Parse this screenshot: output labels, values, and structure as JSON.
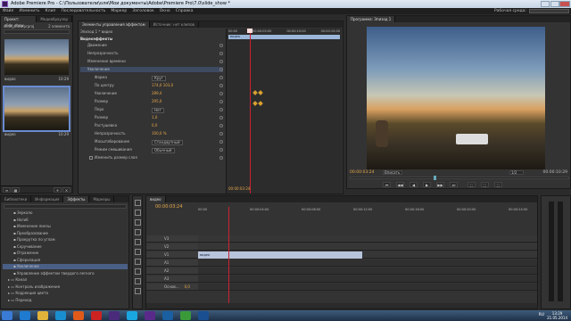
{
  "window": {
    "title": "Adobe Premiere Pro - C:\\Пользователи\\оля\\Мои документы\\Adobe\\Premiere Pro\\7.0\\slide_show *"
  },
  "menu": [
    "Файл",
    "Изменить",
    "Клип",
    "Последовательность",
    "Маркер",
    "Заголовок",
    "Окно",
    "Справка"
  ],
  "workspace_label": "Рабочая среда:",
  "project": {
    "tab": "Проект: slide_show",
    "tab2": "Медиабраузер",
    "file": "slide_show.prproj",
    "count": "2 элемента",
    "items": [
      {
        "name": "видео",
        "dur": "10:29"
      },
      {
        "name": "видео",
        "dur": "10:29"
      }
    ]
  },
  "effect_controls": {
    "tabs": [
      "Элементы управления эффектом",
      "Источник: нет клипов"
    ],
    "clip": "Эпизод 1 * видео",
    "video_effects": "Видеоэффекты",
    "rows": [
      {
        "label": "Движение",
        "indent": 1,
        "fx": true
      },
      {
        "label": "Непрозрачность",
        "indent": 1,
        "fx": true
      },
      {
        "label": "Изменение времени",
        "indent": 1,
        "fx": true
      },
      {
        "label": "Увеличение",
        "indent": 1,
        "fx": true,
        "active": true
      },
      {
        "label": "Форма",
        "indent": 2,
        "value": "Круг",
        "dropdown": true
      },
      {
        "label": "По центру",
        "indent": 2,
        "value": "174,0   103,0"
      },
      {
        "label": "Увеличение",
        "indent": 2,
        "value": "289,4",
        "kf": true
      },
      {
        "label": "Размер",
        "indent": 2,
        "value": "295,0"
      },
      {
        "label": "Перо",
        "indent": 2,
        "value": "Нет",
        "dropdown": true
      },
      {
        "label": "Размер",
        "indent": 2,
        "value": "1,0",
        "kf": true
      },
      {
        "label": "Растушевка",
        "indent": 2,
        "value": "0,0"
      },
      {
        "label": "Непрозрачность",
        "indent": 2,
        "value": "100,0 %"
      },
      {
        "label": "Масштабирование",
        "indent": 2,
        "value": "Стандартный",
        "dropdown": true
      },
      {
        "label": "Режим смешивания",
        "indent": 2,
        "value": "Обычный",
        "dropdown": true
      },
      {
        "label": "Изменить размер слоя",
        "indent": 2,
        "checkbox": true
      }
    ],
    "ruler": [
      "00:00",
      "00:00:05:00",
      "00:00:10:00",
      "00:00:15:00"
    ],
    "clip_label": "видео",
    "timecode": "00:00:03:24"
  },
  "program": {
    "tab": "Программа: Эпизод 1",
    "timecode_left": "00:00:03:24",
    "fit": "Вписать",
    "quality": "1/2",
    "timecode_right": "00:00:10:29",
    "controls": [
      "⏮",
      "◀◀",
      "◀",
      "▶",
      "▶▶",
      "⏭",
      "⬚",
      "⬚",
      "⬚"
    ]
  },
  "effects_panel": {
    "tabs": [
      "Библиотеки",
      "Информация",
      "Эффекты",
      "Маркеры"
    ],
    "items": [
      {
        "label": "Зеркало",
        "indent": 2
      },
      {
        "label": "Нагиб",
        "indent": 2
      },
      {
        "label": "Изменение линзы",
        "indent": 2
      },
      {
        "label": "Преобразование",
        "indent": 2
      },
      {
        "label": "Прокрутка по углам",
        "indent": 2
      },
      {
        "label": "Скручивание",
        "indent": 2
      },
      {
        "label": "Отражение",
        "indent": 2
      },
      {
        "label": "Сферизация",
        "indent": 2
      },
      {
        "label": "Увеличение",
        "indent": 2,
        "selected": true
      },
      {
        "label": "Управление эффектом твердого легкого",
        "indent": 2
      },
      {
        "label": "Канал",
        "indent": 1,
        "folder": true
      },
      {
        "label": "Контроль изображения",
        "indent": 1,
        "folder": true
      },
      {
        "label": "Коррекция цвета",
        "indent": 1,
        "folder": true
      },
      {
        "label": "Переход",
        "indent": 1,
        "folder": true
      }
    ]
  },
  "timeline": {
    "tab": "видео",
    "timecode": "00:00:03:24",
    "ruler": [
      "00:00",
      "00:00:04:00",
      "00:00:08:00",
      "00:00:12:00",
      "00:00:16:00",
      "00:00:20:00",
      "00:00:24:00"
    ],
    "tracks": [
      {
        "name": "V3",
        "type": "video"
      },
      {
        "name": "V2",
        "type": "video"
      },
      {
        "name": "V1",
        "type": "video",
        "clip": "видео"
      },
      {
        "name": "A1",
        "type": "audio"
      },
      {
        "name": "A2",
        "type": "audio"
      },
      {
        "name": "A3",
        "type": "audio"
      },
      {
        "name": "Основ...",
        "type": "master",
        "value": "0,0"
      }
    ]
  },
  "taskbar": {
    "icons": [
      "start",
      "ie",
      "explorer",
      "media",
      "firefox",
      "acrobat",
      "premiere",
      "skype",
      "pr",
      "photoshop",
      "chrome",
      "ps2"
    ],
    "lang": "RU",
    "time": "13:29",
    "date": "21.05.2014"
  }
}
